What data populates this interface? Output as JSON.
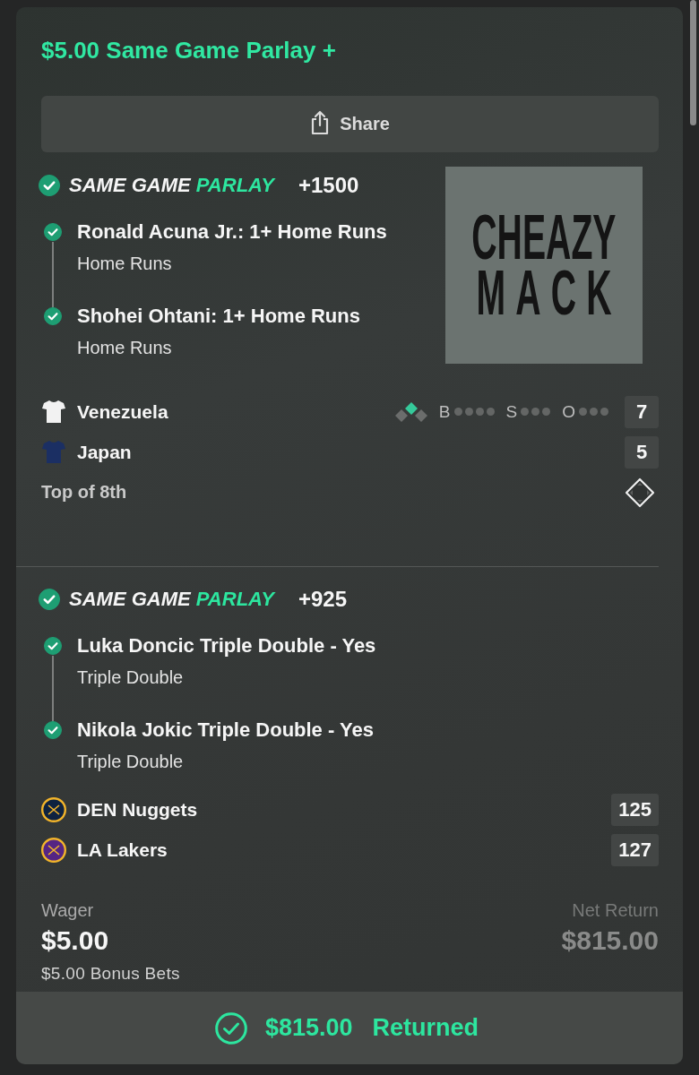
{
  "bet_title": "$5.00 Same Game Parlay +",
  "share_button": {
    "label": "Share"
  },
  "parlays": [
    {
      "won": true,
      "label_part_1": "SAME GAME",
      "label_part_2": "PARLAY",
      "odds": "+1500",
      "legs": [
        {
          "title": "Ronald Acuna Jr.: 1+ Home Runs",
          "market": "Home Runs",
          "won": true
        },
        {
          "title": "Shohei Ohtani: 1+ Home Runs",
          "market": "Home Runs",
          "won": true
        }
      ],
      "logo": {
        "line_1": "CHEAZY",
        "line_2": "MACK"
      },
      "game": {
        "kind": "baseball",
        "teams": [
          {
            "name": "Venezuela",
            "score": "7",
            "color": "#f2f2f2"
          },
          {
            "name": "Japan",
            "score": "5",
            "color": "#1b2f63"
          }
        ],
        "bases": {
          "first": false,
          "second": true,
          "third": false
        },
        "count": [
          {
            "label": "B",
            "dots": [
              {
                "on": false
              },
              {
                "on": false
              },
              {
                "on": false
              },
              {
                "on": false
              }
            ]
          },
          {
            "label": "S",
            "dots": [
              {
                "on": false
              },
              {
                "on": false
              },
              {
                "on": false
              }
            ]
          },
          {
            "label": "O",
            "dots": [
              {
                "on": false
              },
              {
                "on": false
              },
              {
                "on": false
              }
            ]
          }
        ],
        "status": "Top of 8th"
      }
    },
    {
      "won": true,
      "label_part_1": "SAME GAME",
      "label_part_2": "PARLAY",
      "odds": "+925",
      "legs": [
        {
          "title": "Luka Doncic Triple Double - Yes",
          "market": "Triple Double",
          "won": true
        },
        {
          "title": "Nikola Jokic Triple Double - Yes",
          "market": "Triple Double",
          "won": true
        }
      ],
      "game": {
        "kind": "basketball",
        "teams": [
          {
            "name": "DEN Nuggets",
            "score": "125",
            "color": "#0e2240"
          },
          {
            "name": "LA Lakers",
            "score": "127",
            "color": "#552583"
          }
        ]
      }
    }
  ],
  "wager": {
    "label": "Wager",
    "amount": "$5.00",
    "note": "$5.00 Bonus Bets"
  },
  "net_return": {
    "label": "Net Return",
    "amount": "$815.00"
  },
  "result": {
    "amount": "$815.00",
    "label": "Returned"
  }
}
